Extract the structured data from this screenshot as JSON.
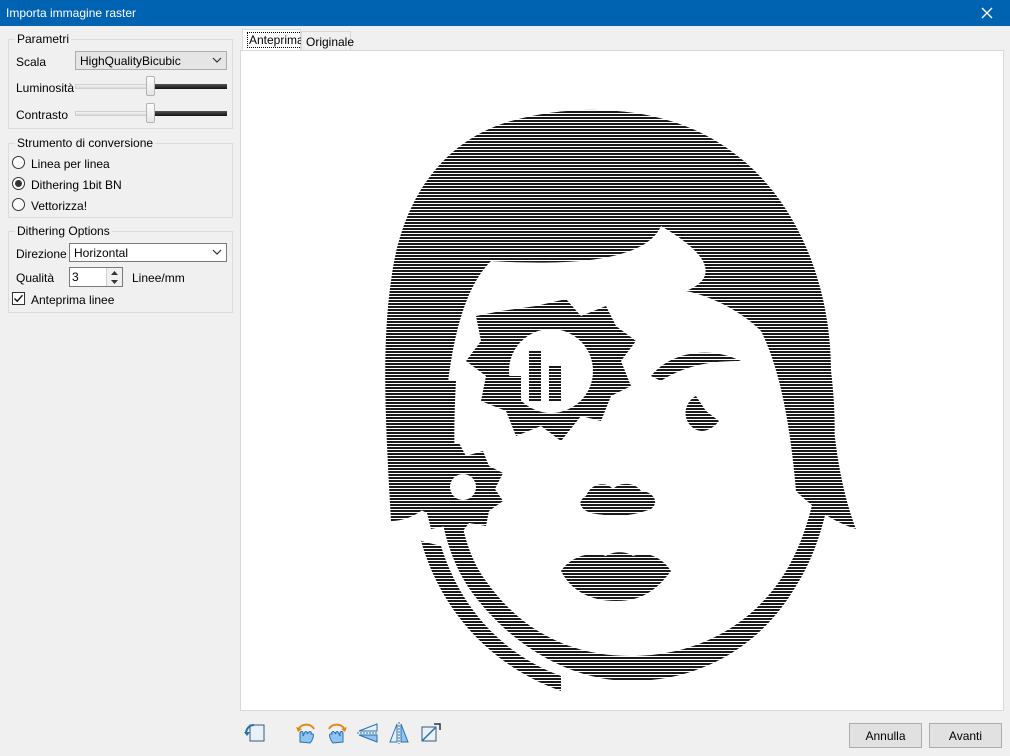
{
  "window": {
    "title": "Importa immagine raster",
    "close_icon": "close-icon"
  },
  "parametri": {
    "legend": "Parametri",
    "scala_label": "Scala",
    "scala_value": "HighQualityBicubic",
    "luminosita_label": "Luminosità",
    "luminosita_value": 0.5,
    "contrasto_label": "Contrasto",
    "contrasto_value": 0.5
  },
  "strumento": {
    "legend": "Strumento di conversione",
    "options": [
      "Linea per linea",
      "Dithering 1bit BN",
      "Vettorizza!"
    ],
    "selected": 1
  },
  "dithering": {
    "legend": "Dithering Options",
    "direzione_label": "Direzione",
    "direzione_value": "Horizontal",
    "qualita_label": "Qualità",
    "qualita_value": "3",
    "qualita_unit": "Linee/mm",
    "anteprima_linee_label": "Anteprima linee",
    "anteprima_linee_checked": true
  },
  "tabs": [
    {
      "label": "Anteprima",
      "selected": true
    },
    {
      "label": "Originale",
      "selected": false
    }
  ],
  "toolbar_icons": [
    "rotate-left-icon",
    "rotate-ccw-hand-icon",
    "rotate-cw-hand-icon",
    "flip-horizontal-icon",
    "flip-vertical-icon",
    "crop-icon"
  ],
  "buttons": {
    "cancel": "Annulla",
    "next": "Avanti"
  }
}
